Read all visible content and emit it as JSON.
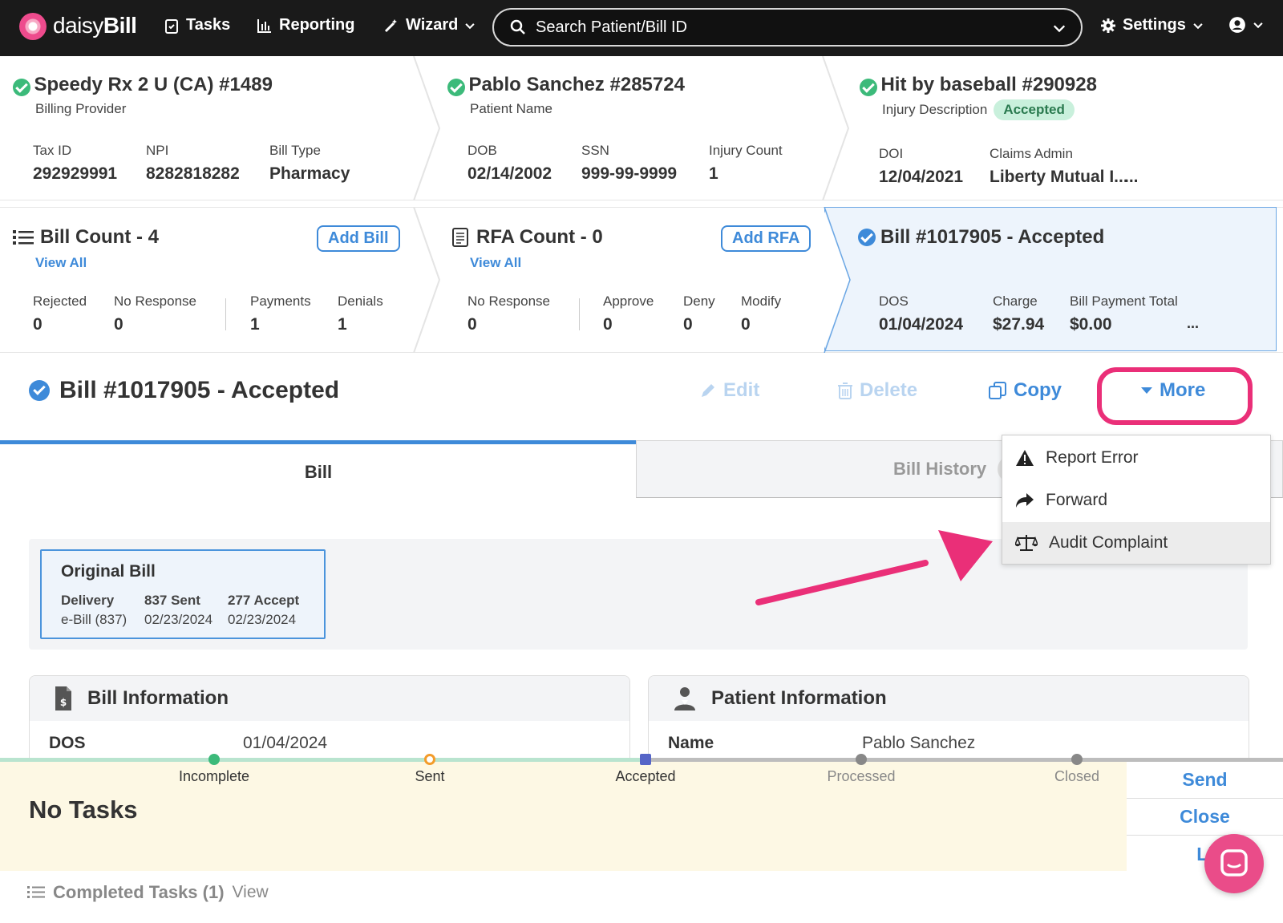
{
  "nav": {
    "brand_light": "daisy",
    "brand_bold": "Bill",
    "tasks": "Tasks",
    "reporting": "Reporting",
    "wizard": "Wizard",
    "search_placeholder": "Search Patient/Bill ID",
    "settings": "Settings"
  },
  "provider": {
    "title": "Speedy Rx 2 U (CA) #1489",
    "subtitle": "Billing Provider",
    "fields": [
      {
        "label": "Tax ID",
        "value": "292929991"
      },
      {
        "label": "NPI",
        "value": "8282818282"
      },
      {
        "label": "Bill Type",
        "value": "Pharmacy"
      }
    ]
  },
  "patient": {
    "title": "Pablo Sanchez #285724",
    "subtitle": "Patient Name",
    "fields": [
      {
        "label": "DOB",
        "value": "02/14/2002"
      },
      {
        "label": "SSN",
        "value": "999-99-9999"
      },
      {
        "label": "Injury Count",
        "value": "1"
      }
    ]
  },
  "injury": {
    "title": "Hit by baseball #290928",
    "subtitle": "Injury Description",
    "badge": "Accepted",
    "fields": [
      {
        "label": "DOI",
        "value": "12/04/2021"
      },
      {
        "label": "Claims Admin",
        "value": "Liberty Mutual I..."
      }
    ],
    "more": "..."
  },
  "bill_count": {
    "title": "Bill Count - 4",
    "view_all": "View All",
    "add_button": "Add Bill",
    "fields": [
      {
        "label": "Rejected",
        "value": "0"
      },
      {
        "label": "No Response",
        "value": "0"
      },
      {
        "label": "Payments",
        "value": "1"
      },
      {
        "label": "Denials",
        "value": "1"
      }
    ]
  },
  "rfa_count": {
    "title": "RFA Count - 0",
    "view_all": "View All",
    "add_button": "Add RFA",
    "fields": [
      {
        "label": "No Response",
        "value": "0"
      },
      {
        "label": "Approve",
        "value": "0"
      },
      {
        "label": "Deny",
        "value": "0"
      },
      {
        "label": "Modify",
        "value": "0"
      }
    ]
  },
  "bill_card": {
    "title": "Bill #1017905 - Accepted",
    "fields": [
      {
        "label": "DOS",
        "value": "01/04/2024"
      },
      {
        "label": "Charge",
        "value": "$27.94"
      },
      {
        "label": "Bill Payment Total",
        "value": "$0.00"
      }
    ],
    "more": "..."
  },
  "bill_header": {
    "title": "Bill #1017905 - Accepted",
    "edit": "Edit",
    "delete": "Delete",
    "copy": "Copy",
    "more": "More"
  },
  "tabs": {
    "bill": "Bill",
    "history": "Bill History"
  },
  "more_menu": {
    "items": [
      "Report Error",
      "Forward",
      "Audit Complaint"
    ]
  },
  "original_bill": {
    "title": "Original Bill",
    "cols": [
      {
        "label": "Delivery",
        "value": "e-Bill (837)"
      },
      {
        "label": "837 Sent",
        "value": "02/23/2024"
      },
      {
        "label": "277 Accept",
        "value": "02/23/2024"
      }
    ]
  },
  "bill_info": {
    "title": "Bill Information",
    "row_label": "DOS",
    "row_value": "01/04/2024"
  },
  "patient_info": {
    "title": "Patient Information",
    "row_label": "Name",
    "row_value": "Pablo Sanchez"
  },
  "status_track": {
    "steps": [
      "Incomplete",
      "Sent",
      "Accepted",
      "Processed",
      "Closed"
    ]
  },
  "tasks": {
    "none": "No Tasks",
    "completed": "Completed Tasks (1)",
    "view": "View"
  },
  "side_actions": {
    "send": "Send",
    "close": "Close",
    "third": "Li"
  },
  "colors": {
    "accent_blue": "#3e8ad9",
    "success_green": "#3cba7a",
    "highlight_pink": "#ea2f78",
    "nav_bg": "#1a1a1a"
  }
}
